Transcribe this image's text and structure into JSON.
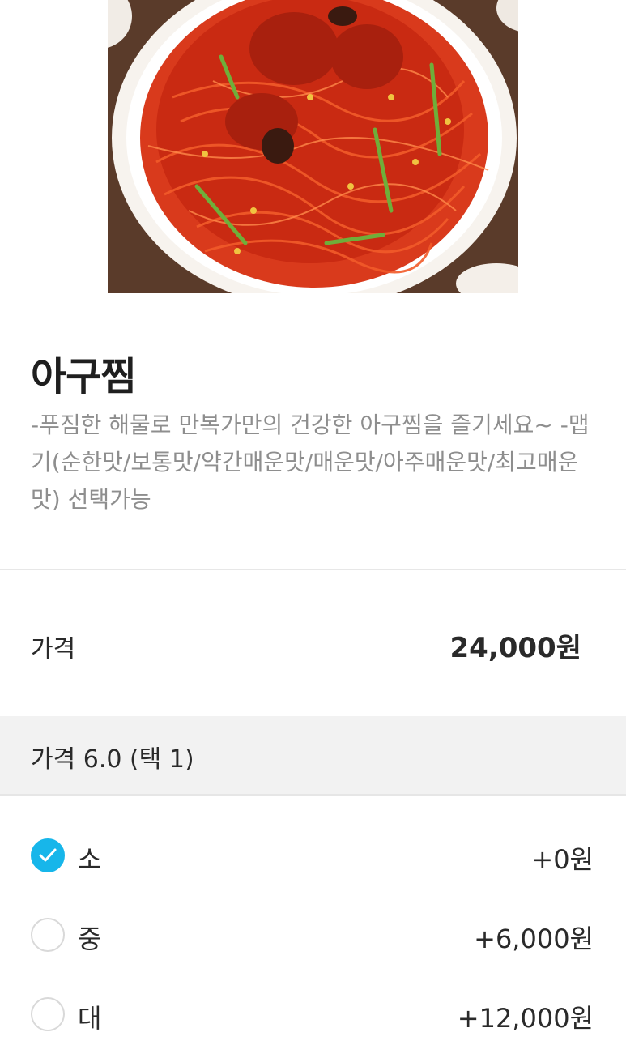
{
  "menu": {
    "title": "아구찜",
    "description": "-푸짐한 해물로 만복가만의 건강한 아구찜을 즐기세요~ -맵기(순한맛/보통맛/약간매운맛/매운맛/아주매운맛/최고매운맛) 선택가능"
  },
  "price": {
    "label": "가격",
    "value": "24,000원"
  },
  "options": {
    "header": "가격 6.0 (택 1)",
    "items": [
      {
        "label": "소",
        "price": "+0원",
        "selected": true
      },
      {
        "label": "중",
        "price": "+6,000원",
        "selected": false
      },
      {
        "label": "대",
        "price": "+12,000원",
        "selected": false
      }
    ]
  },
  "colors": {
    "accent": "#17b6ea",
    "description_text": "#8e8e8e",
    "option_header_bg": "#f2f2f2"
  }
}
